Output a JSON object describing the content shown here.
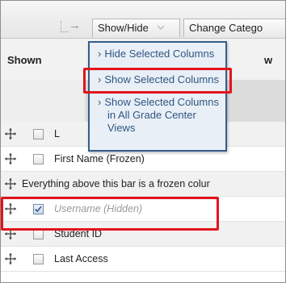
{
  "toolbar": {
    "showhide_label": "Show/Hide",
    "change_category_label": "Change Catego"
  },
  "shown_header": {
    "label": "Shown",
    "right_label": "w"
  },
  "dropdown": {
    "items": [
      {
        "label": "Hide Selected Columns"
      },
      {
        "label": "Show Selected Columns"
      },
      {
        "lines": [
          "Show Selected Columns",
          "in All Grade Center",
          "Views"
        ]
      }
    ]
  },
  "rows": [
    {
      "label": "L",
      "checked": false,
      "state": "normal"
    },
    {
      "label": "First Name (Frozen)",
      "checked": false,
      "state": "normal"
    },
    {
      "label": "Everything above this bar is a frozen colur",
      "state": "frozen-note"
    },
    {
      "label": "Username (Hidden)",
      "checked": true,
      "state": "hidden"
    },
    {
      "label": "Student ID",
      "checked": false,
      "state": "normal"
    },
    {
      "label": "Last Access",
      "checked": false,
      "state": "normal"
    }
  ],
  "icons": {
    "move": "move-arrows-icon",
    "chevron": "chevron-down-icon",
    "menu_arrow": "menu-arrow-icon"
  },
  "colors": {
    "highlight": "#e2141b",
    "menu_text": "#2d5683",
    "menu_bg": "#e9eff6",
    "menu_border": "#355e8a"
  }
}
